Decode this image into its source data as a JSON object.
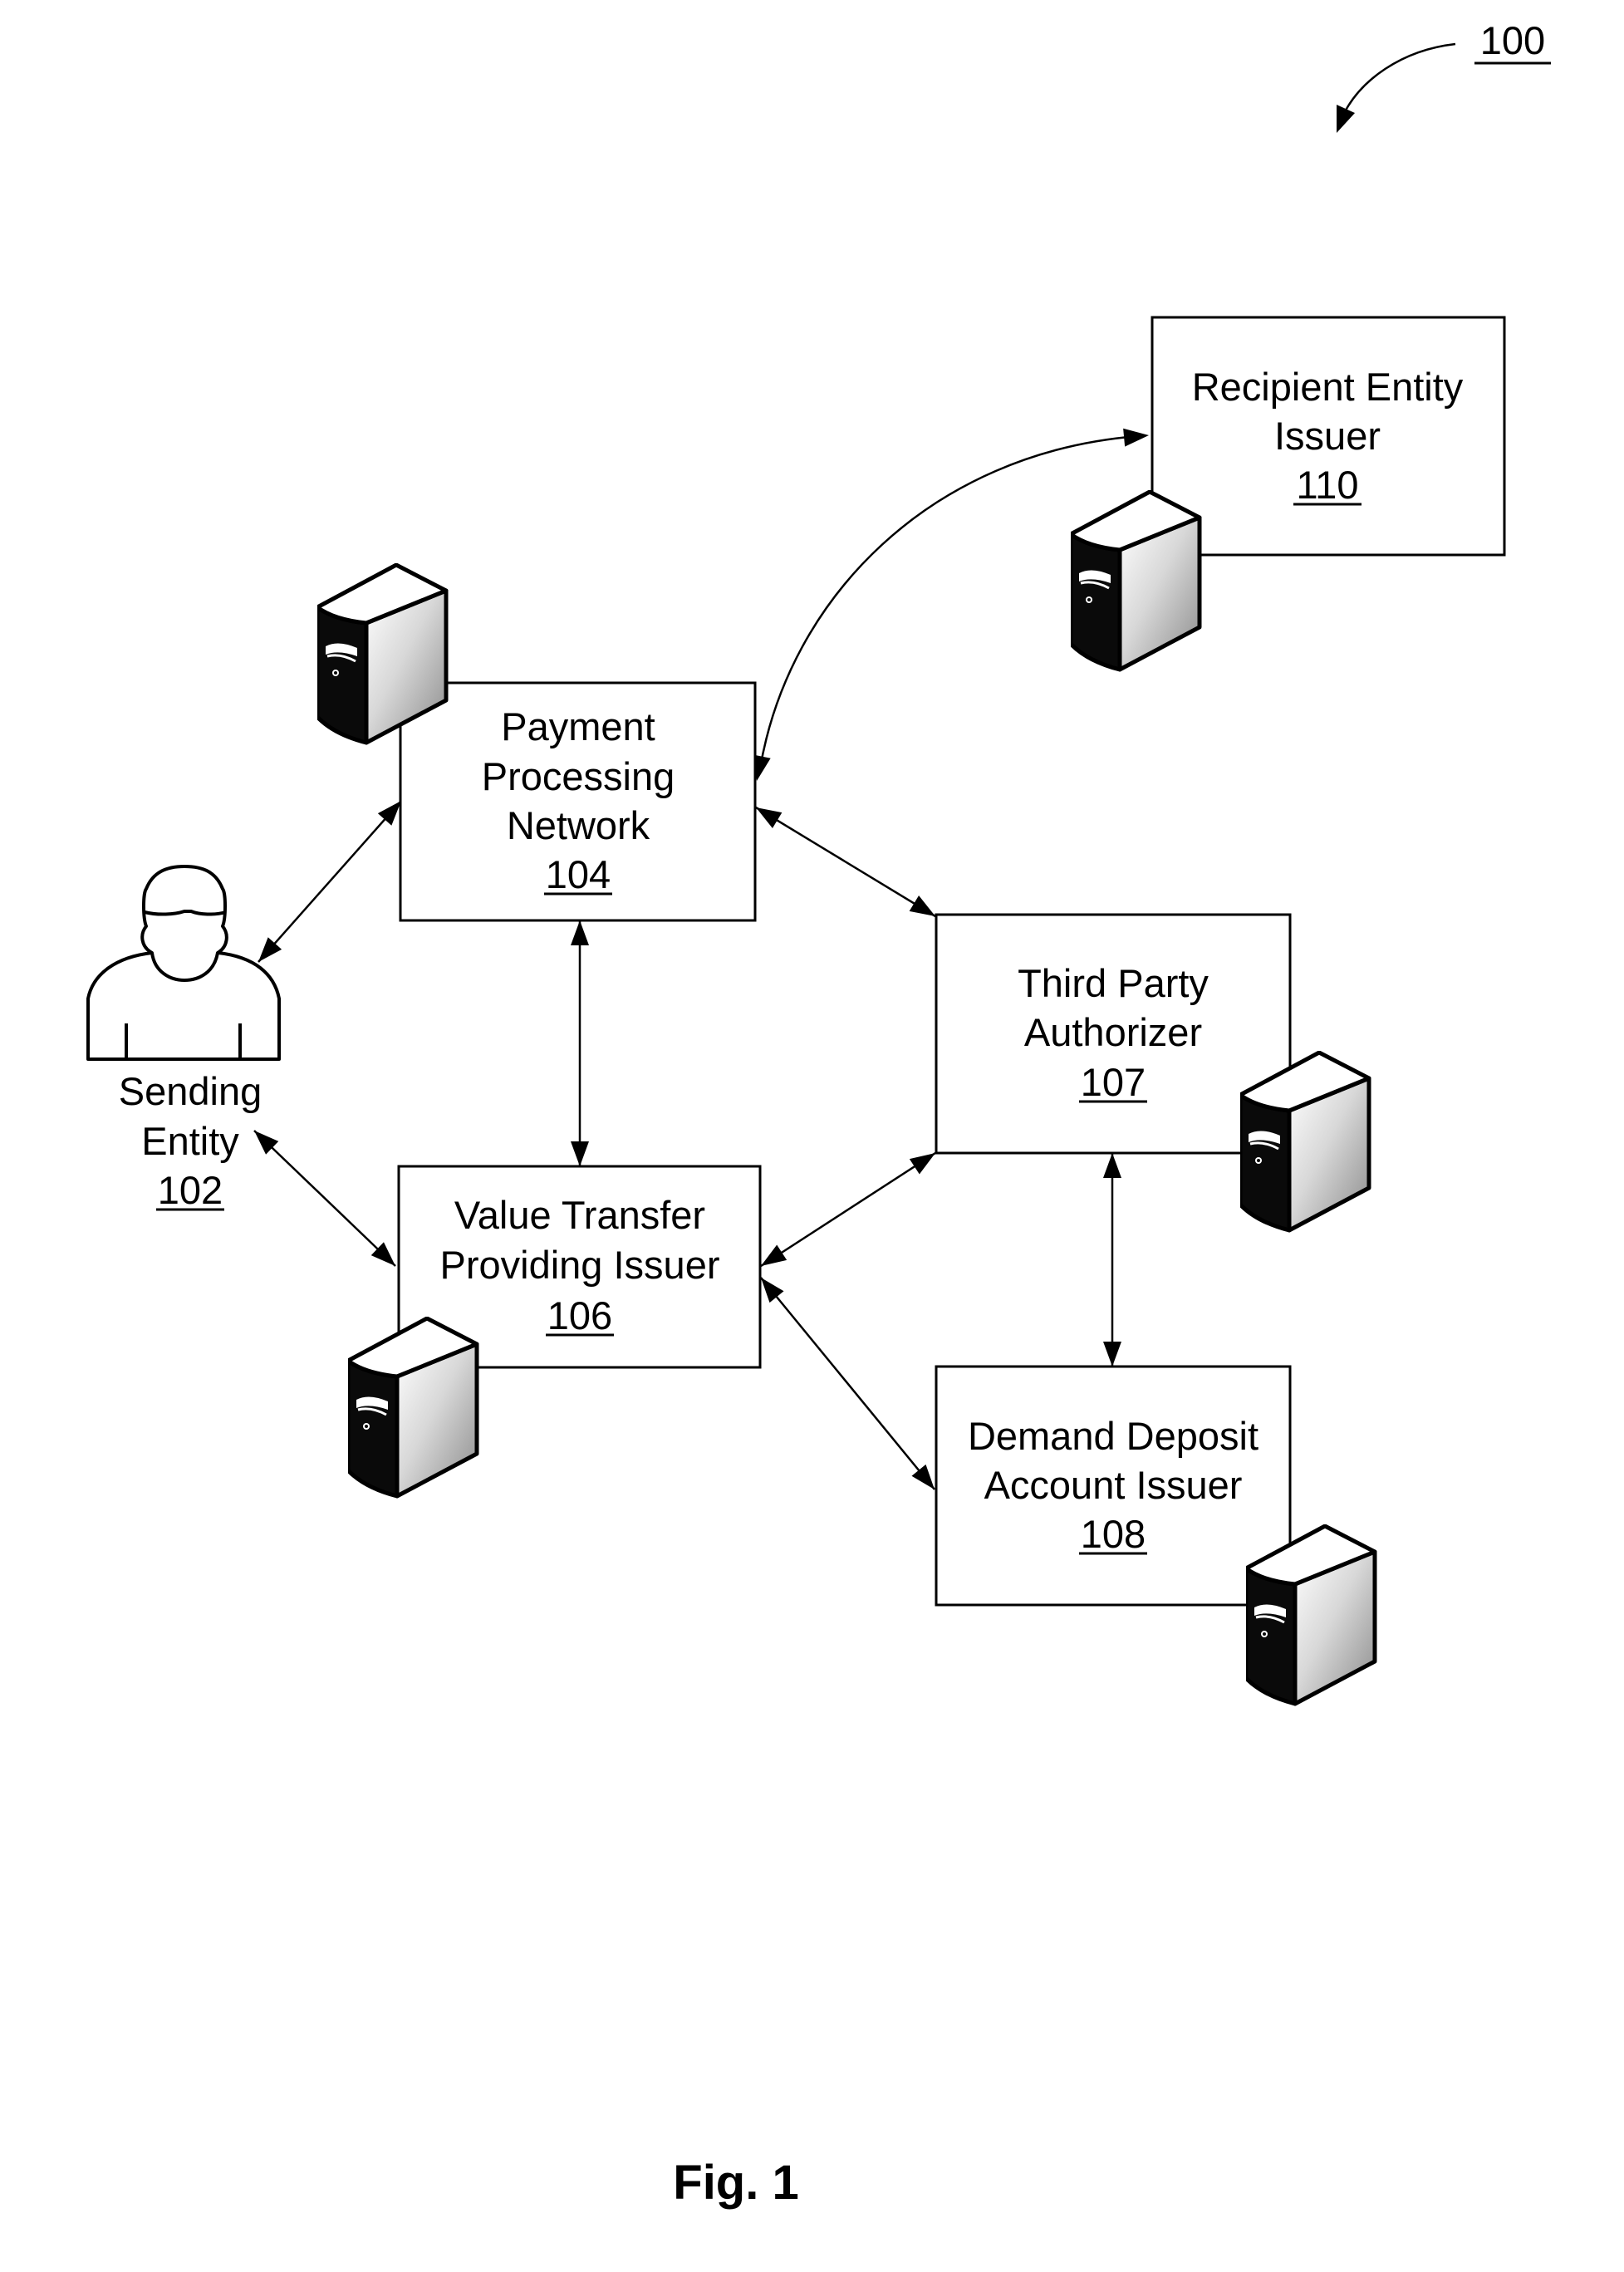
{
  "figure": {
    "reference_number": "100",
    "caption": "Fig. 1"
  },
  "nodes": {
    "sending_entity": {
      "lines": [
        "Sending",
        "Entity"
      ],
      "ref": "102",
      "icon": "person-icon"
    },
    "payment_processing_network": {
      "lines": [
        "Payment",
        "Processing",
        "Network"
      ],
      "ref": "104",
      "icon": "server-icon"
    },
    "value_transfer_providing_issuer": {
      "lines": [
        "Value Transfer",
        "Providing Issuer"
      ],
      "ref": "106",
      "icon": "server-icon"
    },
    "third_party_authorizer": {
      "lines": [
        "Third Party",
        "Authorizer"
      ],
      "ref": "107",
      "icon": "server-icon"
    },
    "demand_deposit_account_issuer": {
      "lines": [
        "Demand Deposit",
        "Account Issuer"
      ],
      "ref": "108",
      "icon": "server-icon"
    },
    "recipient_entity_issuer": {
      "lines": [
        "Recipient Entity",
        "Issuer"
      ],
      "ref": "110",
      "icon": "server-icon"
    }
  },
  "connections": [
    {
      "from": "102",
      "to": "104",
      "type": "bidirectional"
    },
    {
      "from": "102",
      "to": "106",
      "type": "bidirectional"
    },
    {
      "from": "104",
      "to": "106",
      "type": "bidirectional"
    },
    {
      "from": "104",
      "to": "107",
      "type": "bidirectional"
    },
    {
      "from": "104",
      "to": "110",
      "type": "bidirectional-curved"
    },
    {
      "from": "106",
      "to": "107",
      "type": "bidirectional"
    },
    {
      "from": "106",
      "to": "108",
      "type": "bidirectional"
    },
    {
      "from": "107",
      "to": "108",
      "type": "bidirectional"
    }
  ]
}
